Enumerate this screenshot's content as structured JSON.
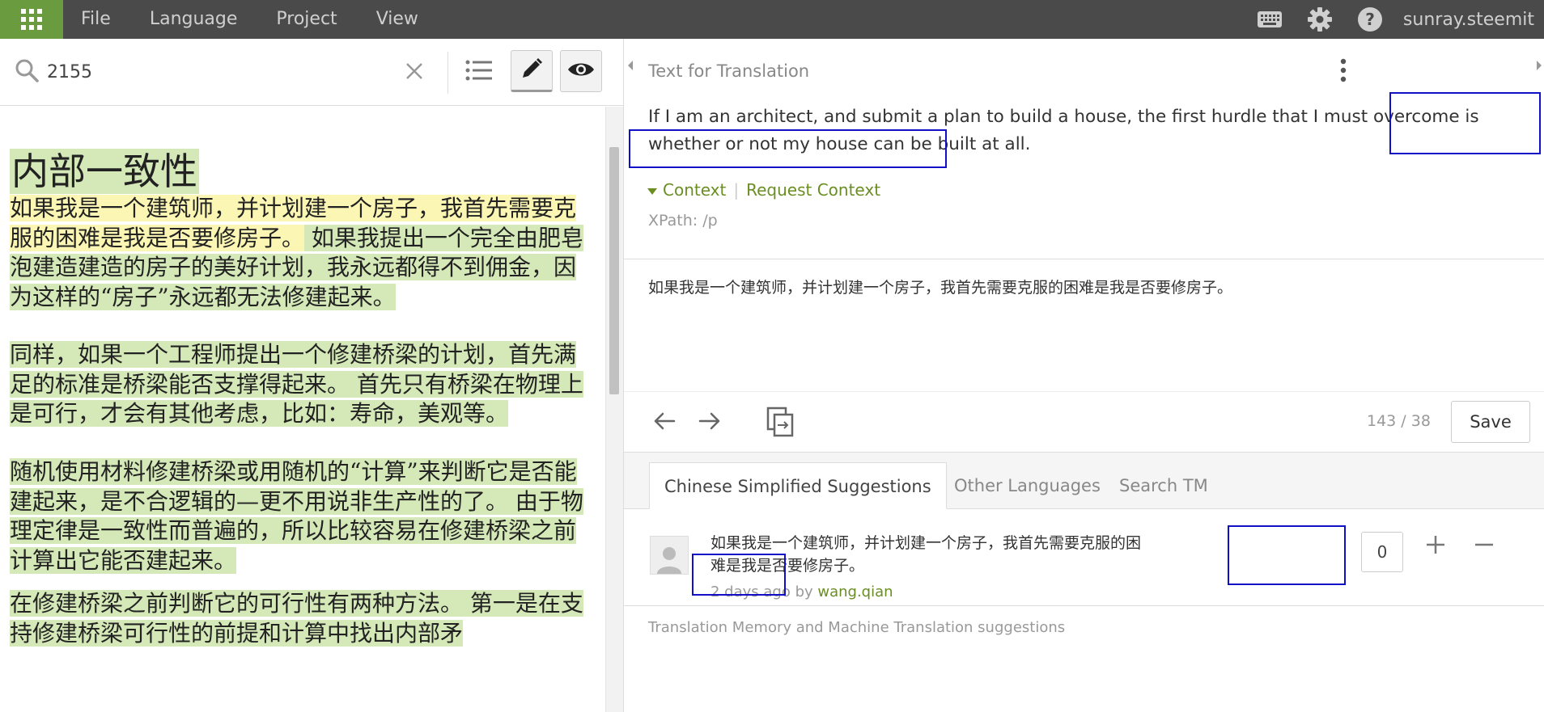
{
  "topbar": {
    "menu": [
      "File",
      "Language",
      "Project",
      "View"
    ],
    "username": "sunray.steemit",
    "accent_color": "#6a9c3f",
    "bg_color": "#4a4a4a"
  },
  "search": {
    "value": "2155"
  },
  "document": {
    "title": "内部一致性",
    "paragraphs": [
      {
        "hl": "如果我是一个建筑师，并计划建一个房子，我首先需要克服的困难是我是否要修房子。",
        "rest": " 如果我提出一个完全由肥皂泡建造建造的房子的美好计划，我永远都得不到佣金，因为这样的“房子”永远都无法修建起来。"
      },
      {
        "hl": "",
        "rest": "同样，如果一个工程师提出一个修建桥梁的计划，首先满足的标准是桥梁能否支撑得起来。 首先只有桥梁在物理上是可行，才会有其他考虑，比如：寿命，美观等。"
      },
      {
        "hl": "",
        "rest": "随机使用材料修建桥梁或用随机的“计算”来判断它是否能建起来，是不合逻辑的—更不用说非生产性的了。 由于物理定律是一致性而普遍的，所以比较容易在修建桥梁之前计算出它能否建起来。"
      },
      {
        "hl": "",
        "rest": "在修建桥梁之前判断它的可行性有两种方法。 第一是在支持修建桥梁可行性的前提和计算中找出内部矛"
      }
    ]
  },
  "editor": {
    "source_label": "Text for Translation",
    "source_text": "If I am an architect, and submit a plan to build a house, the first hurdle that I must overcome is whether or not my house can be built at all.",
    "context_label": "Context",
    "request_context_label": "Request Context",
    "xpath": "XPath: /p",
    "target_text": "如果我是一个建筑师，并计划建一个房子，我首先需要克服的困难是我是否要修房子。",
    "counter": "143 / 38",
    "save_label": "Save",
    "link_color": "#6b8e23"
  },
  "tabs": [
    "Chinese Simplified Suggestions",
    "Other Languages",
    "Search TM"
  ],
  "suggestion": {
    "text": "如果我是一个建筑师，并计划建一个房子，我首先需要克服的困难是我是否要修房子。",
    "age": "2 days ago by ",
    "author": "wang.qian",
    "votes": "0"
  },
  "tm_label": "Translation Memory and Machine Translation suggestions",
  "annotation_color": "#1010c8"
}
